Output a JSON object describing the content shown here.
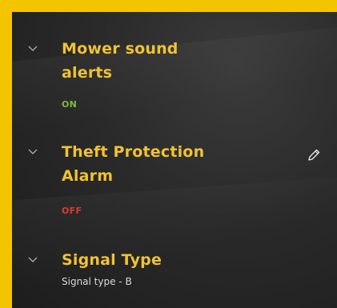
{
  "items": [
    {
      "title": "Mower sound alerts",
      "status": "ON"
    },
    {
      "title": "Theft Protection Alarm",
      "status": "OFF"
    },
    {
      "title": "Signal Type",
      "subtitle": "Signal type - B"
    }
  ],
  "icons": {
    "expand": "chevron-down-icon",
    "edit": "pencil-icon"
  },
  "colors": {
    "frame": "#f5c400",
    "title": "#f1c232",
    "on": "#7dbb3c",
    "off": "#e0392f"
  }
}
